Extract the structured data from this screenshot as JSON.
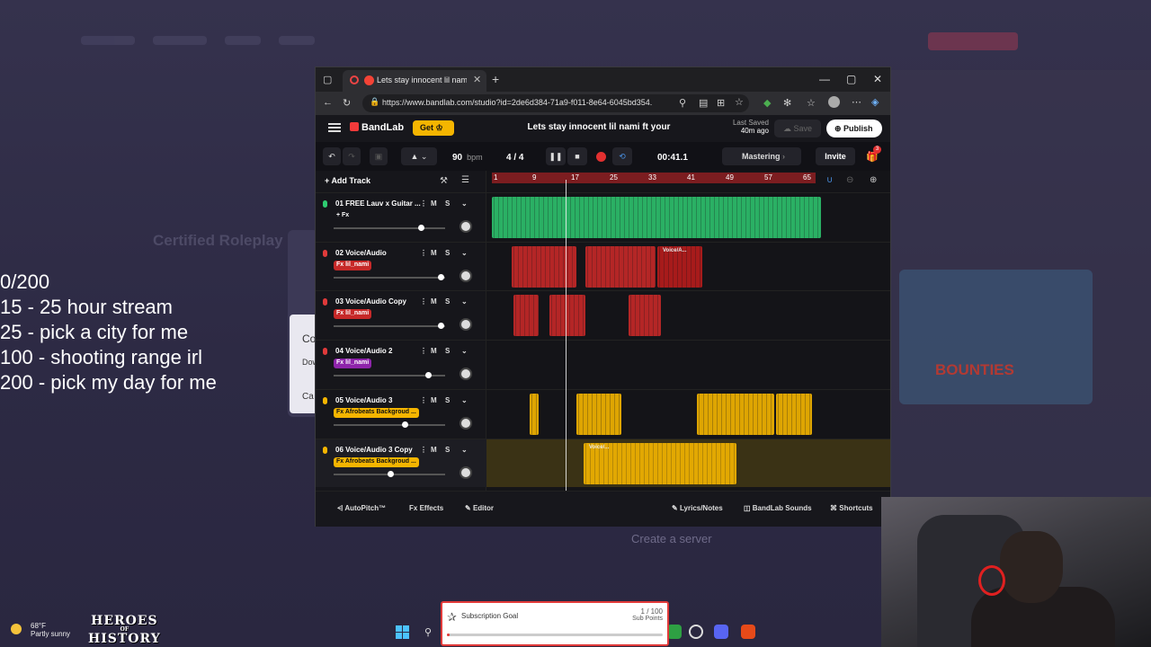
{
  "overlay": {
    "goals": [
      "0/200",
      "15 - 25 hour stream",
      "25 - pick a city for me",
      "100 - shooting range irl",
      "200 - pick my day for me"
    ]
  },
  "background": {
    "title": "Certified Roleplay",
    "card_text_1": "Co",
    "card_text_2": "Dow",
    "card_text_3": "Ca",
    "poster_text": "BOUNTIES",
    "server_text": "Create a server"
  },
  "browser": {
    "tab_title": "Lets stay innocent lil nami ft",
    "url": "https://www.bandlab.com/studio?id=2de6d384-71a9-f011-8e64-6045bd354..."
  },
  "app": {
    "logo": "BandLab",
    "get_label": "Get",
    "project_title": "Lets stay innocent lil nami ft your",
    "last_saved_label": "Last Saved",
    "last_saved_value": "40m ago",
    "save_label": "Save",
    "publish_label": "Publish",
    "bpm_value": "90",
    "bpm_unit": "bpm",
    "time_sig": "4 / 4",
    "timecode": "00:41.1",
    "mastering_label": "Mastering",
    "invite_label": "Invite",
    "notification_count": "3",
    "add_track_label": "Add Track",
    "ruler_marks": [
      "1",
      "9",
      "17",
      "25",
      "33",
      "41",
      "49",
      "57",
      "65"
    ],
    "tracks": [
      {
        "name": "01  FREE Lauv x Guitar ...",
        "fx": "+ Fx",
        "mic_color": "#2ecc71",
        "fx_color": "transparent",
        "volume": 0.78
      },
      {
        "name": "02  Voice/Audio",
        "fx": "Fx lil_nami",
        "mic_color": "#e03a3a",
        "fx_color": "#c62828",
        "volume": 0.97
      },
      {
        "name": "03  Voice/Audio Copy",
        "fx": "Fx lil_nami",
        "mic_color": "#e03a3a",
        "fx_color": "#c62828",
        "volume": 0.97
      },
      {
        "name": "04  Voice/Audio 2",
        "fx": "Fx lil_nami",
        "mic_color": "#e03a3a",
        "fx_color": "#8e24aa",
        "volume": 0.85
      },
      {
        "name": "05  Voice/Audio 3",
        "fx": "Fx Afrobeats Backgroud ...",
        "mic_color": "#f5b500",
        "fx_color": "#f5b500",
        "volume": 0.63
      },
      {
        "name": "06  Voice/Audio 3 Copy",
        "fx": "Fx Afrobeats Backgroud ...",
        "mic_color": "#f5b500",
        "fx_color": "#f5b500",
        "volume": 0.5
      }
    ],
    "clip_labels": [
      "Voice/A...",
      "Voice/..."
    ],
    "footer": {
      "autopitch": "AutoPitch™",
      "effects": "Effects",
      "editor": "Editor",
      "lyrics": "Lyrics/Notes",
      "sounds": "BandLab Sounds",
      "shortcuts": "Shortcuts"
    }
  },
  "taskbar": {
    "temp": "68°F",
    "weather": "Partly sunny",
    "heroes_line1": "HEROES",
    "heroes_line2": "OF",
    "heroes_line3": "HISTORY"
  },
  "subscription_goal": {
    "label": "Subscription Goal",
    "count": "1 / 100",
    "unit": "Sub Points",
    "progress": 0.01
  }
}
